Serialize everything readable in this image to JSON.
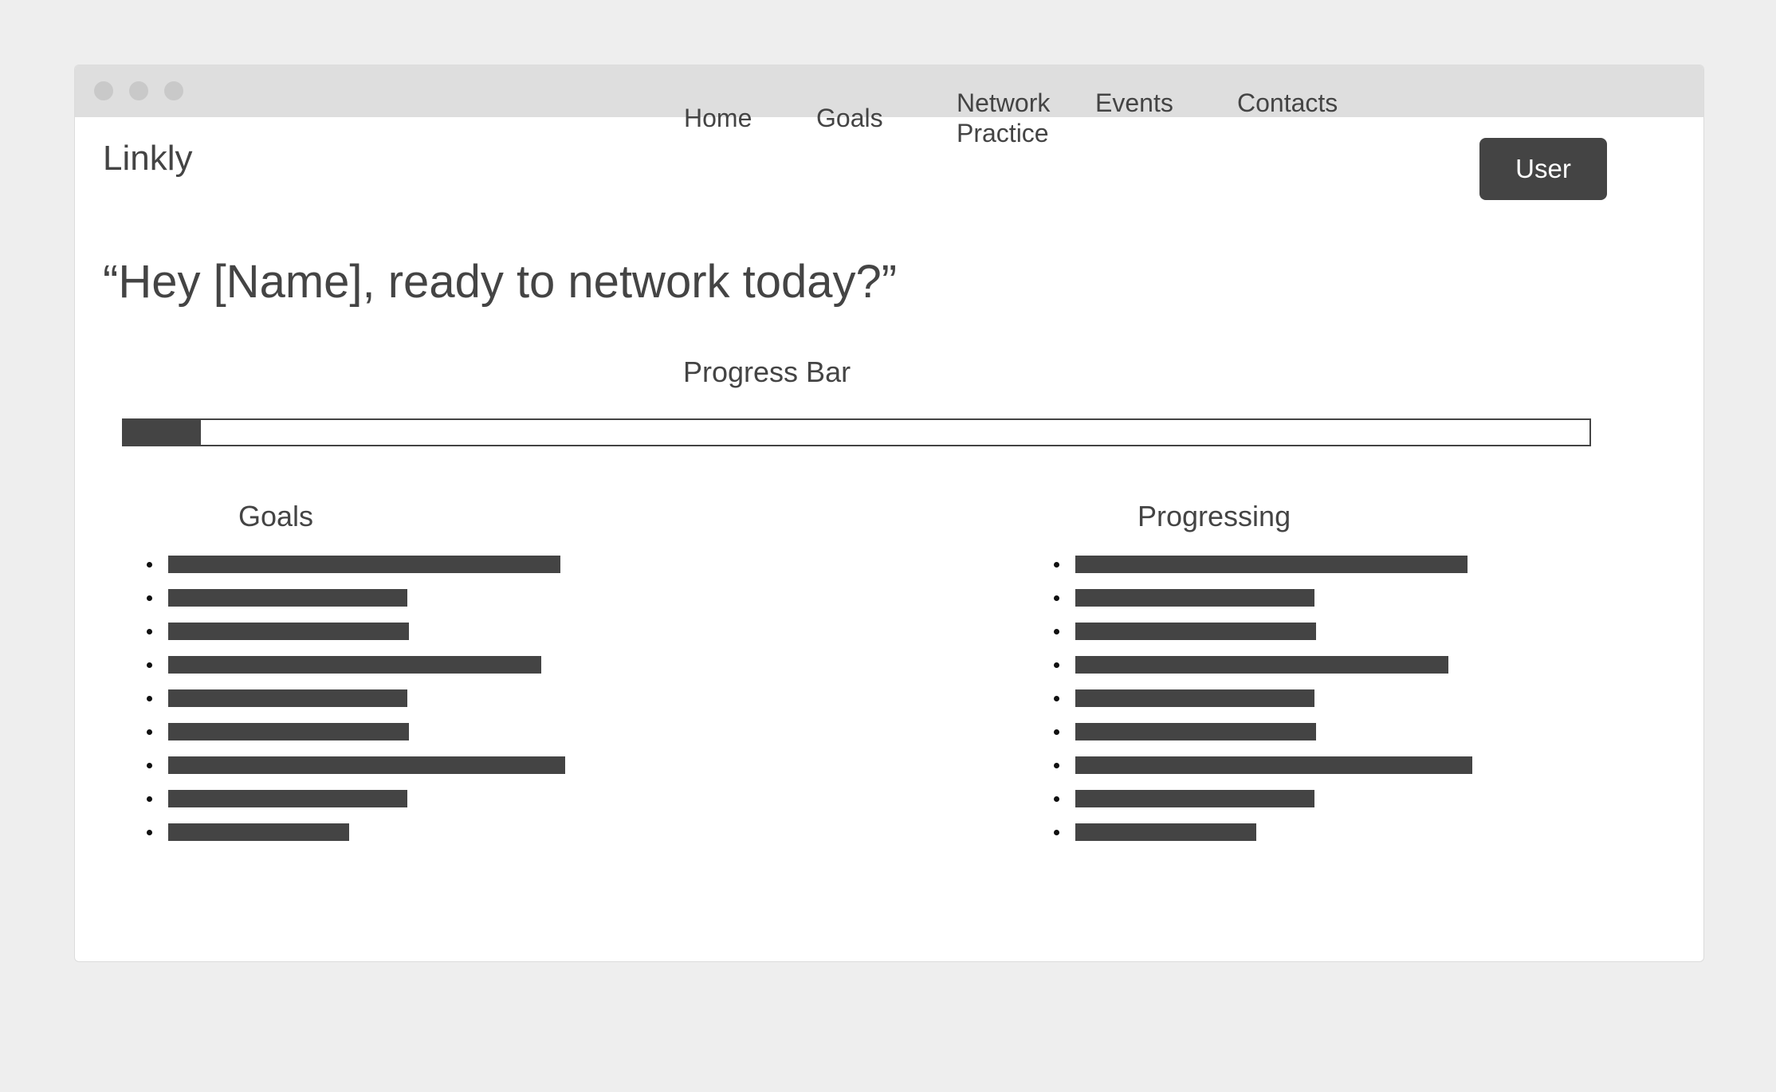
{
  "app": {
    "logo": "Linkly"
  },
  "nav": {
    "home": "Home",
    "goals": "Goals",
    "network_practice_line1": "Network",
    "network_practice_line2": "Practice",
    "events": "Events",
    "contacts": "Contacts",
    "user_button": "User"
  },
  "main": {
    "greeting": "“Hey [Name], ready to network today?”",
    "progress_label": "Progress Bar",
    "progress_value": 0.053,
    "goals_heading": "Goals",
    "progressing_heading": "Progressing"
  },
  "lists": {
    "goals_item_count": 9,
    "progressing_item_count": 9
  },
  "colors": {
    "accent": "#444444",
    "background": "#eeeeee",
    "window": "#ffffff",
    "titlebar": "#dedede"
  }
}
